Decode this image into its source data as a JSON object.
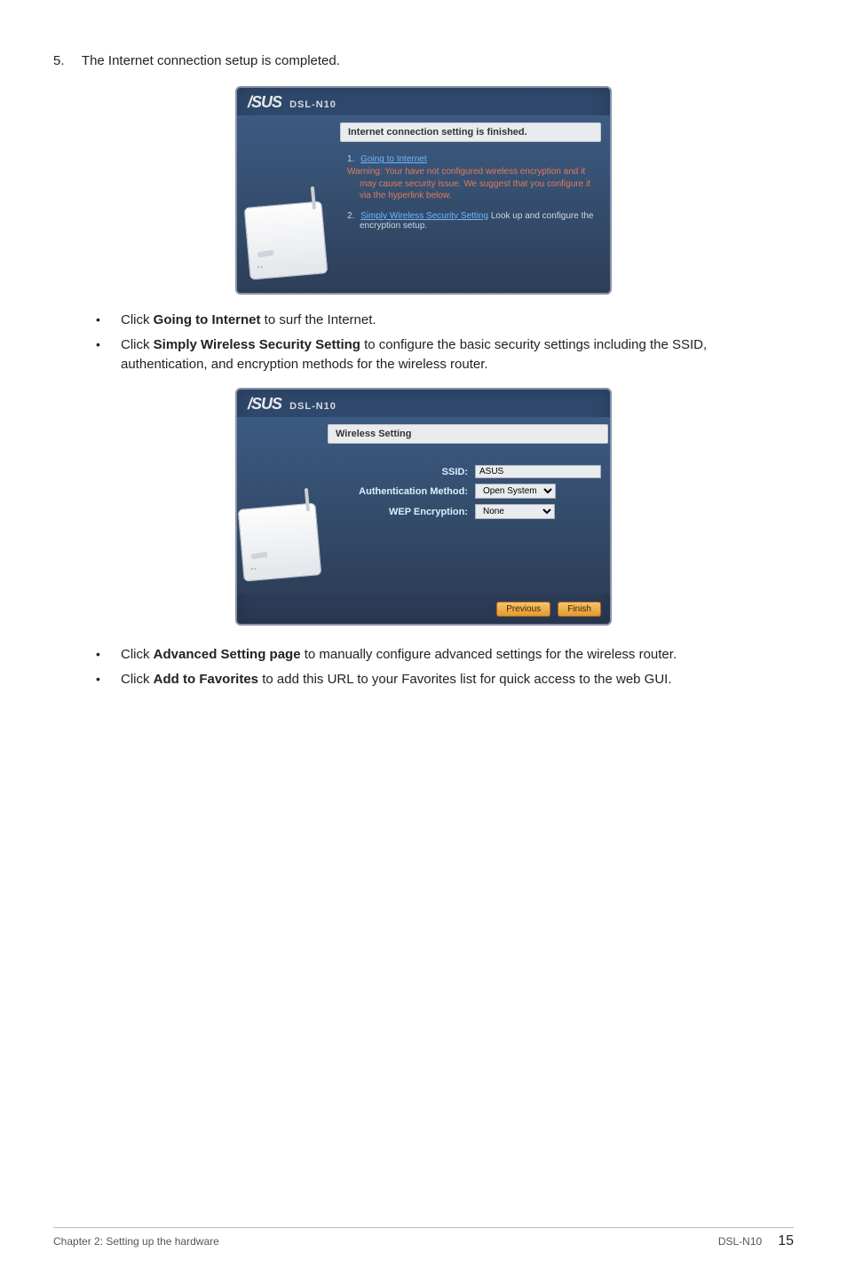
{
  "step": {
    "num": "5.",
    "text": "The Internet connection setup is completed."
  },
  "shot1": {
    "brand": "/SUS",
    "model": "DSL-N10",
    "titlebar": "Internet connection setting is finished.",
    "item1_num": "1.",
    "item1_link": "Going to Internet",
    "item1_warn": "Warning: Your have not configured wireless encryption and it may cause security issue. We suggest that you configure it via the hyperlink below.",
    "item2_num": "2.",
    "item2_link": "Simply Wireless Security Setting",
    "item2_rest": " Look up and configure the encryption setup."
  },
  "bullets1": {
    "b1_pre": "Click ",
    "b1_bold": "Going to Internet",
    "b1_post": " to surf the Internet.",
    "b2_pre": "Click ",
    "b2_bold": "Simply Wireless Security Setting",
    "b2_post": " to configure the basic security settings including the SSID, authentication, and encryption methods for the wireless router."
  },
  "shot2": {
    "brand": "/SUS",
    "model": "DSL-N10",
    "titlebar": "Wireless Setting",
    "ssid_label": "SSID:",
    "ssid_value": "ASUS",
    "auth_label": "Authentication Method:",
    "auth_value": "Open System",
    "wep_label": "WEP Encryption:",
    "wep_value": "None",
    "prev": "Previous",
    "finish": "Finish"
  },
  "bullets2": {
    "b1_pre": "Click ",
    "b1_bold": "Advanced Setting page",
    "b1_post": " to manually configure advanced settings for the wireless router.",
    "b2_pre": "Click ",
    "b2_bold": "Add to Favorites",
    "b2_post": " to add this URL to your Favorites list for quick access to the web GUI."
  },
  "footer": {
    "left": "Chapter 2: Setting up the hardware",
    "model": "DSL-N10",
    "page": "15"
  }
}
